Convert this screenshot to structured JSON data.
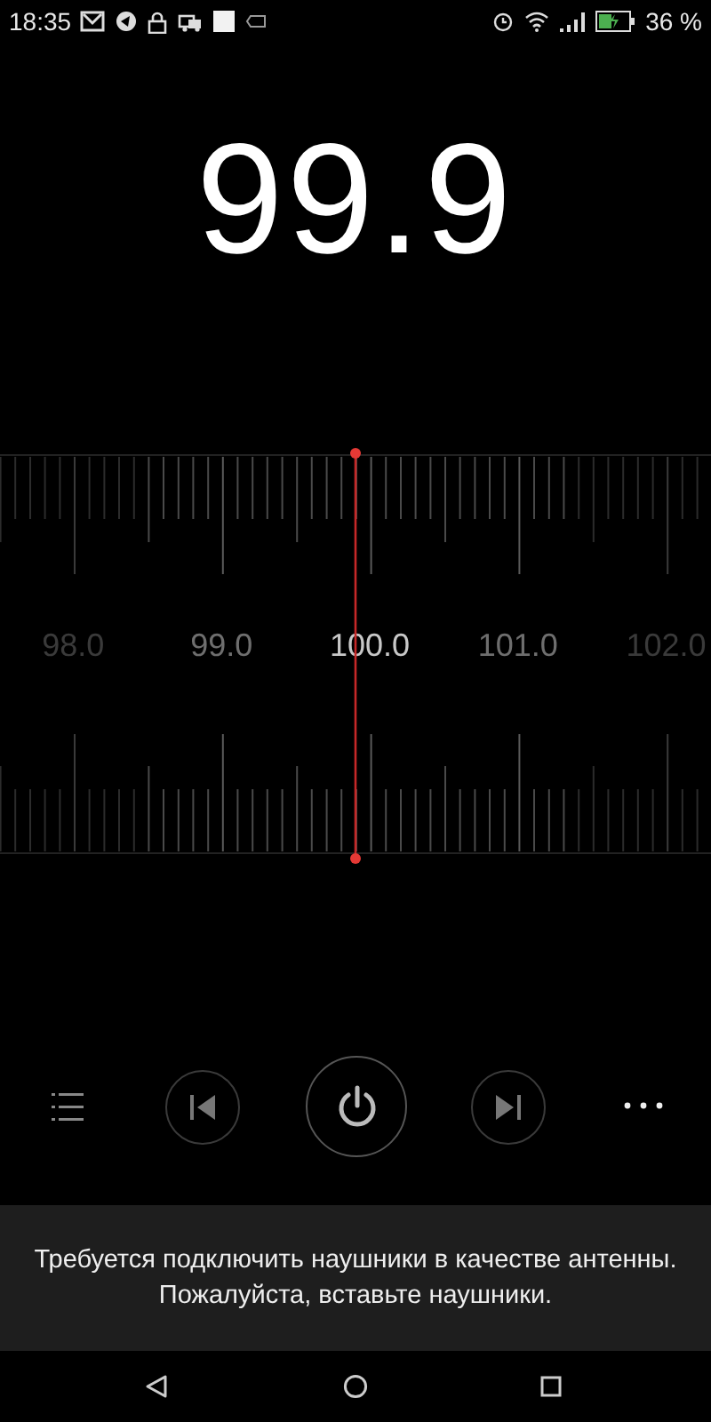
{
  "status_bar": {
    "time": "18:35",
    "battery": "36 %"
  },
  "frequency": "99.9",
  "dial": {
    "labels": [
      "98.0",
      "99.0",
      "100.0",
      "101.0",
      "102.0"
    ]
  },
  "toast": {
    "lines": [
      "Требуется подключить наушники в качестве антенны.",
      "Пожалуйста, вставьте наушники."
    ]
  }
}
